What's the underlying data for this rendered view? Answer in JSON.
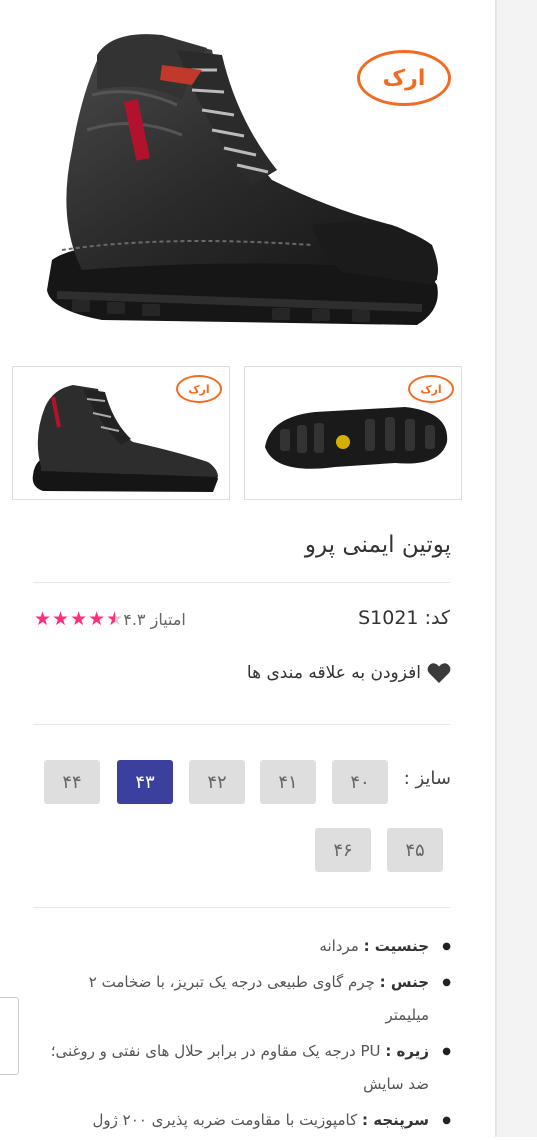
{
  "brand": {
    "logo_text": "ارک"
  },
  "product": {
    "title": "پوتین ایمنی پرو",
    "code_label": "کد: S1021",
    "rating_label": "امتیاز ۴.۳",
    "rating_value": 4.3,
    "rating_max": 5,
    "wishlist_label": "افزودن به علاقه مندی ها"
  },
  "sizes": {
    "label": "سایز :",
    "options": [
      "۴۰",
      "۴۱",
      "۴۲",
      "۴۳",
      "۴۴",
      "۴۵",
      "۴۶"
    ],
    "selected": "۴۳"
  },
  "specs": [
    {
      "key": "جنسیت :",
      "value": " مردانه"
    },
    {
      "key": "جنس :",
      "value": " چرم گاوی طبیعی درجه یک تبریز، با ضخامت ۲ میلیمتر"
    },
    {
      "key": "زیره :",
      "value": " PU درجه یک مقاوم در برابر حلال های نفتی و روغنی؛ ضد سایش"
    },
    {
      "key": "سرپنجه :",
      "value": " کامپوزیت با مقاومت ضربه پذیری ۲۰۰ ژول"
    }
  ],
  "colors": {
    "accent": "#3b3f9e",
    "star": "#ff2f7d",
    "logo": "#f36b21"
  }
}
